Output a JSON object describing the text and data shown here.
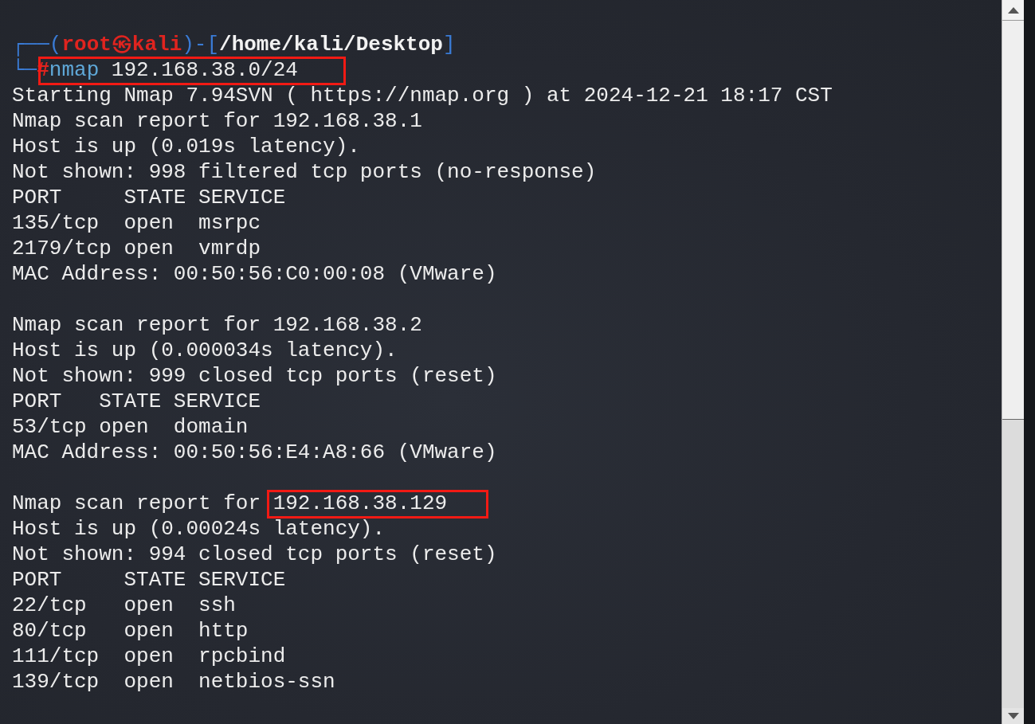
{
  "prompt": {
    "segments": [
      {
        "text": "┌──(",
        "kind": "frame"
      },
      {
        "text": "root㉿kali",
        "kind": "user"
      },
      {
        "text": ")-[",
        "kind": "frame"
      },
      {
        "text": "/home/kali/Desktop",
        "kind": "path"
      },
      {
        "text": "]",
        "kind": "frame"
      }
    ],
    "corner": "└─",
    "symbol": "#",
    "command": {
      "program": "nmap",
      "args": "192.168.38.0/24",
      "highlighted": true
    }
  },
  "output_blocks": [
    [
      {
        "text": "Starting Nmap 7.94SVN ( https://nmap.org ) at 2024-12-21 18:17 CST",
        "highlighted": false
      },
      {
        "text": "Nmap scan report for 192.168.38.1",
        "highlighted": false
      },
      {
        "text": "Host is up (0.019s latency).",
        "highlighted": false
      },
      {
        "text": "Not shown: 998 filtered tcp ports (no-response)",
        "highlighted": false
      },
      {
        "text": "PORT     STATE SERVICE",
        "highlighted": false
      },
      {
        "text": "135/tcp  open  msrpc",
        "highlighted": false
      },
      {
        "text": "2179/tcp open  vmrdp",
        "highlighted": false
      },
      {
        "text": "MAC Address: 00:50:56:C0:00:08 (VMware)",
        "highlighted": false
      }
    ],
    [
      {
        "text": "Nmap scan report for 192.168.38.2",
        "highlighted": false
      },
      {
        "text": "Host is up (0.000034s latency).",
        "highlighted": false
      },
      {
        "text": "Not shown: 999 closed tcp ports (reset)",
        "highlighted": false
      },
      {
        "text": "PORT   STATE SERVICE",
        "highlighted": false
      },
      {
        "text": "53/tcp open  domain",
        "highlighted": false
      },
      {
        "text": "MAC Address: 00:50:56:E4:A8:66 (VMware)",
        "highlighted": false
      }
    ],
    [
      {
        "text": "Nmap scan report for 192.168.38.129",
        "highlighted": true
      },
      {
        "text": "Host is up (0.00024s latency).",
        "highlighted": false
      },
      {
        "text": "Not shown: 994 closed tcp ports (reset)",
        "highlighted": false
      },
      {
        "text": "PORT     STATE SERVICE",
        "highlighted": false
      },
      {
        "text": "22/tcp   open  ssh",
        "highlighted": false
      },
      {
        "text": "80/tcp   open  http",
        "highlighted": false
      },
      {
        "text": "111/tcp  open  rpcbind",
        "highlighted": false
      },
      {
        "text": "139/tcp  open  netbios-ssn",
        "highlighted": false
      }
    ]
  ]
}
